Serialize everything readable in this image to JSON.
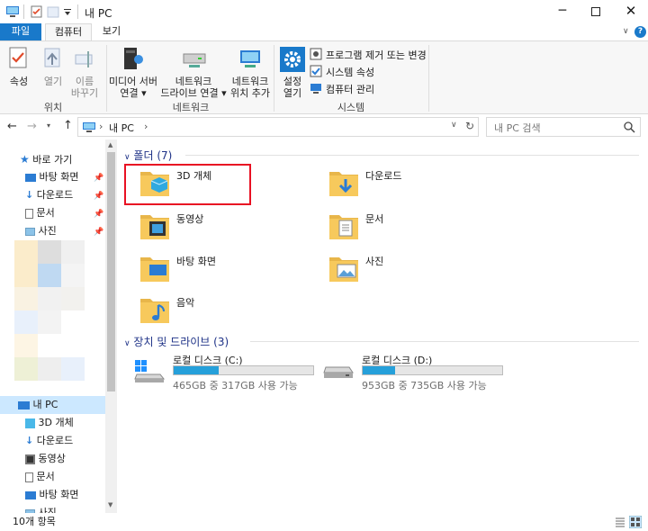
{
  "window": {
    "title": "내 PC"
  },
  "tabs": {
    "file": "파일",
    "computer": "컴퓨터",
    "view": "보기"
  },
  "ribbon": {
    "properties": "속성",
    "open": "열기",
    "rename_l1": "이름",
    "rename_l2": "바꾸기",
    "group_location": "위치",
    "media_l1": "미디어 서버",
    "media_l2": "연결",
    "netdrive_l1": "네트워크",
    "netdrive_l2": "드라이브 연결",
    "netloc_l1": "네트워크",
    "netloc_l2": "위치 추가",
    "group_network": "네트워크",
    "settings_l1": "설정",
    "settings_l2": "열기",
    "uninstall": "프로그램 제거 또는 변경",
    "sysprops": "시스템 속성",
    "compmgmt": "컴퓨터 관리",
    "group_system": "시스템"
  },
  "address": {
    "path": "내 PC",
    "search_placeholder": "내 PC 검색"
  },
  "nav": {
    "quick_access": "바로 가기",
    "quick_items": [
      "바탕 화면",
      "다운로드",
      "문서",
      "사진"
    ],
    "this_pc": "내 PC",
    "pc_items": [
      "3D 개체",
      "다운로드",
      "동영상",
      "문서",
      "바탕 화면",
      "사진"
    ]
  },
  "folders_header": "폴더 (7)",
  "folders": [
    "3D 개체",
    "다운로드",
    "동영상",
    "문서",
    "바탕 화면",
    "사진",
    "음악"
  ],
  "drives_header": "장치 및 드라이브 (3)",
  "drives": [
    {
      "name": "로컬 디스크 (C:)",
      "info": "465GB 중 317GB 사용 가능",
      "used_fraction": 0.32
    },
    {
      "name": "로컬 디스크 (D:)",
      "info": "953GB 중 735GB 사용 가능",
      "used_fraction": 0.23
    }
  ],
  "status": {
    "count": "10개 항목"
  },
  "colors": {
    "accent": "#1979ca",
    "selection_box": "#e81123",
    "drive_bar": "#26a0da",
    "folder": "#f7c95c"
  }
}
